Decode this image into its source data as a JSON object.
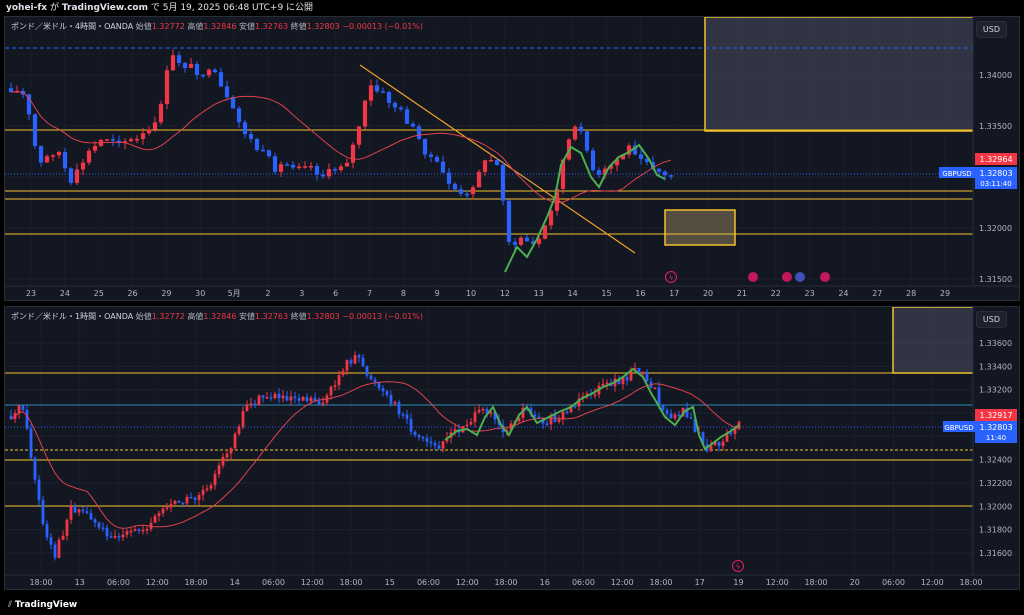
{
  "header": {
    "user": "yohei-fx",
    "ga": "が",
    "site": "TradingView.com",
    "de": "で",
    "date": "5月 19, 2025 06:48 UTC+9 に公開"
  },
  "footer": {
    "brand": "TradingView"
  },
  "colors": {
    "up": "#f23645",
    "down": "#2962ff",
    "ma": "#e0414f",
    "yellowLine": "#f2c22b",
    "blueLine": "#2a8eb8",
    "swing": "#4caf50",
    "bg": "#131722"
  },
  "panels": [
    {
      "legend": {
        "title": "ポンド／米ドル・4時間・OANDA",
        "o_label": "始値",
        "o": "1.32772",
        "h_label": "高値",
        "h": "1.32846",
        "l_label": "安値",
        "l": "1.32763",
        "c_label": "終値",
        "c": "1.32803",
        "chg": "−0.00013 (−0.01%)"
      },
      "currency": "USD",
      "price_labels": [
        "1.34000",
        "1.33500",
        "1.32500",
        "1.32000",
        "1.31500"
      ],
      "time_labels": [
        "23",
        "24",
        "25",
        "26",
        "29",
        "30",
        "5月",
        "2",
        "3",
        "6",
        "7",
        "8",
        "9",
        "10",
        "12",
        "13",
        "14",
        "15",
        "16",
        "17",
        "20",
        "21",
        "22",
        "23",
        "24",
        "27",
        "28",
        "29"
      ],
      "red_tag": "1.32964",
      "sym_tag": {
        "symbol": "GBPUSD",
        "price": "1.32803",
        "countdown": "03:11:40"
      }
    },
    {
      "legend": {
        "title": "ポンド／米ドル・1時間・OANDA",
        "o_label": "始値",
        "o": "1.32772",
        "h_label": "高値",
        "h": "1.32846",
        "l_label": "安値",
        "l": "1.32763",
        "c_label": "終値",
        "c": "1.32803",
        "chg": "−0.00013 (−0.01%)"
      },
      "currency": "USD",
      "price_labels": [
        "1.33600",
        "1.33400",
        "1.33200",
        "1.33000",
        "1.32600",
        "1.32400",
        "1.32200",
        "1.32000",
        "1.31800",
        "1.31600"
      ],
      "time_labels": [
        "18:00",
        "13",
        "06:00",
        "12:00",
        "18:00",
        "14",
        "06:00",
        "12:00",
        "18:00",
        "15",
        "06:00",
        "12:00",
        "18:00",
        "16",
        "06:00",
        "12:00",
        "18:00",
        "17",
        "19",
        "12:00",
        "18:00",
        "20",
        "06:00",
        "12:00",
        "18:00"
      ],
      "red_tag": "1.32917",
      "sym_tag": {
        "symbol": "GBPUSD",
        "price": "1.32803",
        "countdown": "11:40"
      }
    }
  ]
}
